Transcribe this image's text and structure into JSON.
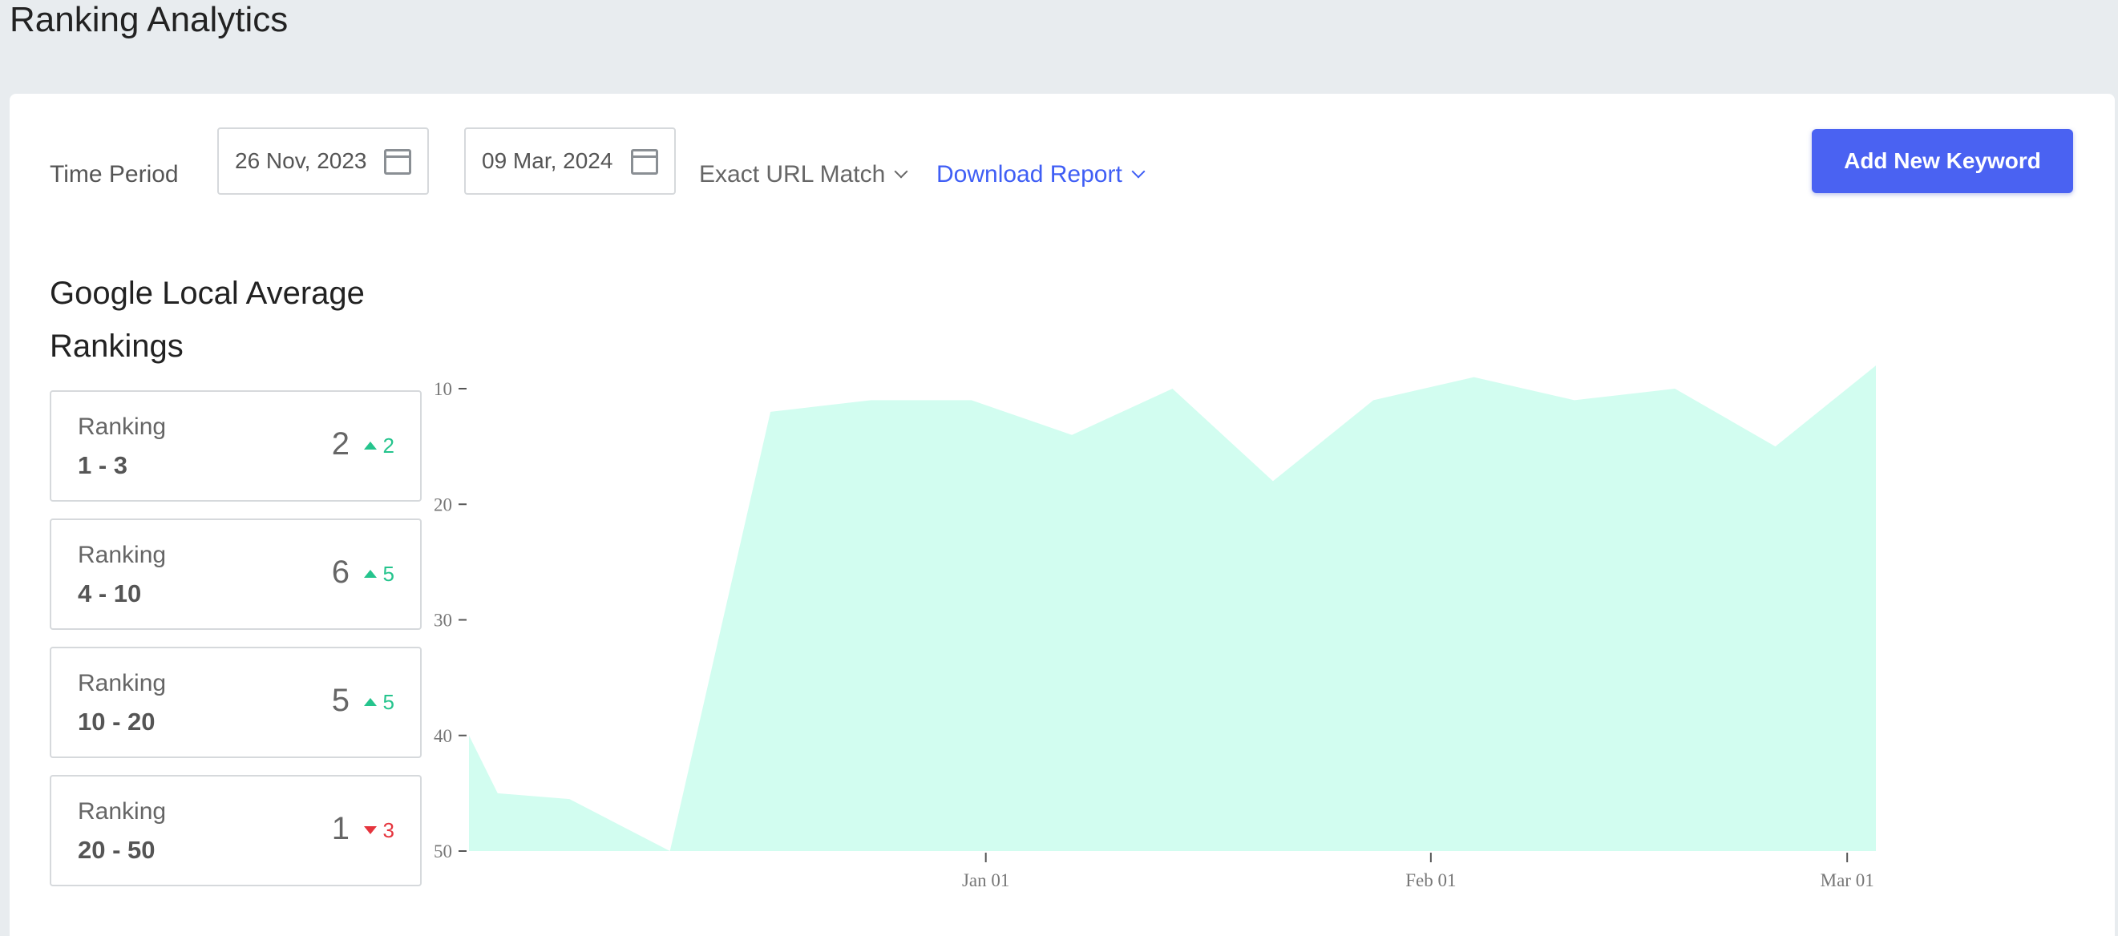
{
  "page_title": "Ranking Analytics",
  "toolbar": {
    "time_period_label": "Time Period",
    "start_date": "26 Nov, 2023",
    "end_date": "09 Mar, 2024",
    "url_match_label": "Exact URL Match",
    "download_label": "Download Report",
    "add_keyword_label": "Add New Keyword",
    "accent_color": "#4a62f2"
  },
  "section_title": "Google Local Average Rankings",
  "rankings": [
    {
      "label": "Ranking",
      "range": "1 - 3",
      "count": "2",
      "delta": "2",
      "direction": "up"
    },
    {
      "label": "Ranking",
      "range": "4 - 10",
      "count": "6",
      "delta": "5",
      "direction": "up"
    },
    {
      "label": "Ranking",
      "range": "10 - 20",
      "count": "5",
      "delta": "5",
      "direction": "up"
    },
    {
      "label": "Ranking",
      "range": "20 - 50",
      "count": "1",
      "delta": "3",
      "direction": "down"
    }
  ],
  "chart_data": {
    "type": "area",
    "x_range": [
      "2023-11-26",
      "2024-03-03"
    ],
    "ylim": [
      50,
      10
    ],
    "y_ticks": [
      10,
      20,
      30,
      40,
      50
    ],
    "x_ticks": [
      {
        "date": "2024-01-01",
        "label": "Jan 01"
      },
      {
        "date": "2024-02-01",
        "label": "Feb 01"
      },
      {
        "date": "2024-03-01",
        "label": "Mar 01"
      }
    ],
    "fill_color": "#d2fdf0",
    "points": [
      {
        "x": "2023-11-26",
        "y": 40
      },
      {
        "x": "2023-11-28",
        "y": 45
      },
      {
        "x": "2023-12-03",
        "y": 45.5
      },
      {
        "x": "2023-12-10",
        "y": 50
      },
      {
        "x": "2023-12-17",
        "y": 12
      },
      {
        "x": "2023-12-24",
        "y": 11
      },
      {
        "x": "2023-12-31",
        "y": 11
      },
      {
        "x": "2024-01-07",
        "y": 14
      },
      {
        "x": "2024-01-14",
        "y": 10
      },
      {
        "x": "2024-01-21",
        "y": 18
      },
      {
        "x": "2024-01-28",
        "y": 11
      },
      {
        "x": "2024-02-04",
        "y": 9
      },
      {
        "x": "2024-02-11",
        "y": 11
      },
      {
        "x": "2024-02-18",
        "y": 10
      },
      {
        "x": "2024-02-25",
        "y": 15
      },
      {
        "x": "2024-03-03",
        "y": 8
      }
    ]
  }
}
